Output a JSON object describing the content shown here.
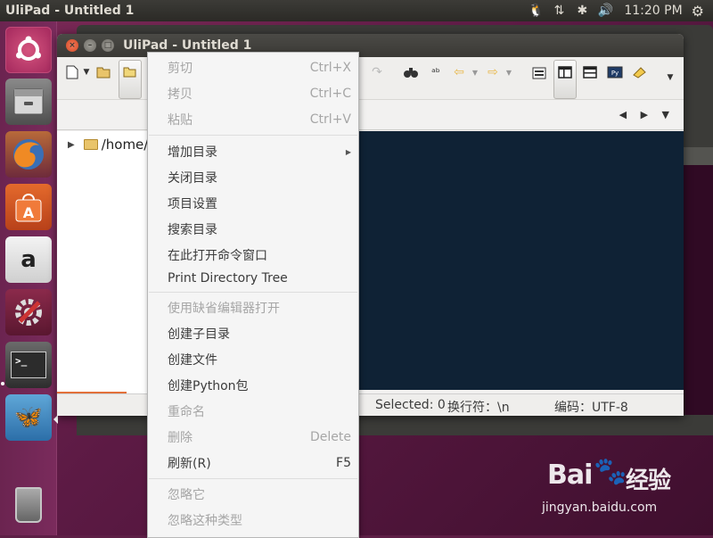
{
  "top_panel": {
    "app_title": "UliPad - Untitled 1",
    "indicators": [
      "🐧",
      "⇅",
      "✱",
      "🔊"
    ],
    "clock": "11:20 PM",
    "settings_icon": "⚙"
  },
  "launcher": {
    "items": [
      "ubuntu-dash",
      "files",
      "firefox",
      "ubuntu-software",
      "amazon",
      "system-settings",
      "terminal",
      "ulipad",
      "trash"
    ],
    "amazon_glyph": "a",
    "terminal_glyph": ">_",
    "ulipad_glyph": "🦋"
  },
  "window": {
    "title": "UliPad - Untitled 1",
    "close_glyph": "×",
    "min_glyph": "–",
    "max_glyph": "□"
  },
  "tree": {
    "expander": "▶",
    "root_label": "/home/"
  },
  "tab_nav": "◀ ▶ ▼",
  "status": {
    "selected": "Selected: 0",
    "eol": "换行符：\\n",
    "encoding": "编码：UTF-8"
  },
  "menu": {
    "cut": {
      "label": "剪切",
      "shortcut": "Ctrl+X"
    },
    "copy": {
      "label": "拷贝",
      "shortcut": "Ctrl+C"
    },
    "paste": {
      "label": "粘贴",
      "shortcut": "Ctrl+V"
    },
    "add_dir": {
      "label": "增加目录",
      "arrow": "▶"
    },
    "close_dir": {
      "label": "关闭目录"
    },
    "project_settings": {
      "label": "项目设置"
    },
    "search_dir": {
      "label": "搜索目录"
    },
    "open_cmd": {
      "label": "在此打开命令窗口"
    },
    "print_tree": {
      "label": "Print Directory Tree"
    },
    "open_default_editor": {
      "label": "使用缺省编辑器打开"
    },
    "create_subdir": {
      "label": "创建子目录"
    },
    "create_file": {
      "label": "创建文件"
    },
    "create_package": {
      "label": "创建Python包"
    },
    "rename": {
      "label": "重命名"
    },
    "delete": {
      "label": "删除",
      "shortcut": "Delete"
    },
    "refresh": {
      "label": "刷新(R)",
      "shortcut": "F5"
    },
    "ignore_it": {
      "label": "忽略它"
    },
    "ignore_type": {
      "label": "忽略这种类型"
    }
  },
  "watermark": {
    "logo": "Bai",
    "logo2": "经验",
    "url": "jingyan.baidu.com"
  },
  "colors": {
    "desktop": "#5e1f46",
    "editor_bg": "#0f2235",
    "accent_orange": "#e2703a"
  }
}
